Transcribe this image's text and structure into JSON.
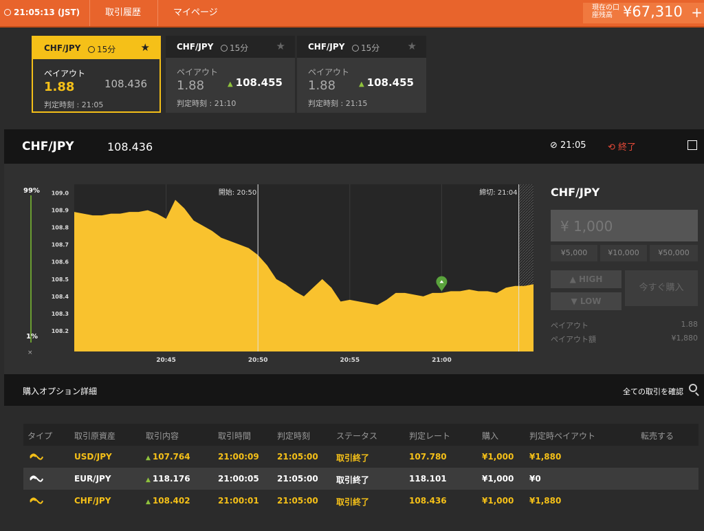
{
  "topbar": {
    "time": "21:05:13 (JST)",
    "nav": [
      "取引履歴",
      "マイページ"
    ],
    "balance_label": "現在の口座残高",
    "balance": "¥67,310",
    "plus": "+"
  },
  "cards": [
    {
      "pair": "CHF/JPY",
      "duration": "15分",
      "payout_label": "ペイアウト",
      "payout": "1.88",
      "rate": "108.436",
      "rate_arrow": false,
      "judge": "判定時刻 : 21:05",
      "active": true
    },
    {
      "pair": "CHF/JPY",
      "duration": "15分",
      "payout_label": "ペイアウト",
      "payout": "1.88",
      "rate": "108.455",
      "rate_arrow": true,
      "judge": "判定時刻 : 21:10",
      "active": false
    },
    {
      "pair": "CHF/JPY",
      "duration": "15分",
      "payout_label": "ペイアウト",
      "payout": "1.88",
      "rate": "108.455",
      "rate_arrow": true,
      "judge": "判定時刻 : 21:15",
      "active": false
    }
  ],
  "header": {
    "pair": "CHF/JPY",
    "rate": "108.436",
    "time": "21:05",
    "status": "終了"
  },
  "gauge": {
    "top": "99%",
    "bottom": "1%",
    "close": "×",
    "level": 0.99
  },
  "chart_data": {
    "type": "area",
    "title": "",
    "xlabel": "",
    "ylabel": "",
    "x_ticks": [
      "20:45",
      "20:50",
      "20:55",
      "21:00"
    ],
    "y_ticks": [
      "109.0",
      "108.9",
      "108.8",
      "108.7",
      "108.6",
      "108.5",
      "108.4",
      "108.3",
      "108.2"
    ],
    "ylim": [
      108.08,
      109.05
    ],
    "xlim": [
      0,
      25
    ],
    "start_label": "開始: 20:50",
    "end_label": "締切: 21:04",
    "start_x": 10,
    "end_x": 24.2,
    "entry": {
      "x": 20,
      "y": 108.43
    },
    "series": [
      {
        "x": [
          0,
          0.5,
          1,
          1.5,
          2,
          2.5,
          3,
          3.5,
          4,
          4.5,
          5,
          5.5,
          6,
          6.5,
          7,
          7.5,
          8,
          8.5,
          9,
          9.5,
          10,
          10.5,
          11,
          11.5,
          12,
          12.5,
          13,
          13.5,
          14,
          14.5,
          15,
          15.5,
          16,
          16.5,
          17,
          17.5,
          18,
          18.5,
          19,
          19.5,
          20,
          20.5,
          21,
          21.5,
          22,
          22.5,
          23,
          23.5,
          24,
          24.5,
          25
        ],
        "values": [
          108.89,
          108.88,
          108.87,
          108.87,
          108.88,
          108.88,
          108.89,
          108.89,
          108.9,
          108.88,
          108.85,
          108.96,
          108.91,
          108.84,
          108.81,
          108.78,
          108.74,
          108.72,
          108.7,
          108.68,
          108.64,
          108.58,
          108.5,
          108.47,
          108.43,
          108.4,
          108.45,
          108.5,
          108.45,
          108.37,
          108.38,
          108.37,
          108.36,
          108.35,
          108.38,
          108.42,
          108.42,
          108.41,
          108.4,
          108.42,
          108.42,
          108.43,
          108.43,
          108.44,
          108.43,
          108.43,
          108.42,
          108.45,
          108.46,
          108.46,
          108.47
        ]
      }
    ]
  },
  "side": {
    "pair": "CHF/JPY",
    "amount_placeholder": "¥ 1,000",
    "quick": [
      "¥5,000",
      "¥10,000",
      "¥50,000"
    ],
    "high": "HIGH",
    "low": "LOW",
    "buy": "今すぐ購入",
    "payout_label": "ペイアウト",
    "payout_value": "1.88",
    "payout_amount_label": "ペイアウト額",
    "payout_amount_value": "¥1,880"
  },
  "details": {
    "title": "購入オプション詳細",
    "all_link": "全ての取引を確認",
    "columns": [
      "タイプ",
      "取引原資産",
      "取引内容",
      "取引時間",
      "判定時刻",
      "ステータス",
      "判定レート",
      "購入",
      "判定時ペイアウト",
      "転売する"
    ],
    "rows": [
      {
        "asset": "USD/JPY",
        "content": "107.764",
        "time": "21:00:09",
        "judge": "21:05:00",
        "status": "取引終了",
        "rate": "107.780",
        "buy": "¥1,000",
        "payout": "¥1,880",
        "color": "#f5c018"
      },
      {
        "asset": "EUR/JPY",
        "content": "118.176",
        "time": "21:00:05",
        "judge": "21:05:00",
        "status": "取引終了",
        "rate": "118.101",
        "buy": "¥1,000",
        "payout": "¥0",
        "color": "#ffffff"
      },
      {
        "asset": "CHF/JPY",
        "content": "108.402",
        "time": "21:00:01",
        "judge": "21:05:00",
        "status": "取引終了",
        "rate": "108.436",
        "buy": "¥1,000",
        "payout": "¥1,880",
        "color": "#f5c018"
      }
    ]
  },
  "colors": {
    "accent": "#e8642c",
    "yellow": "#f5c018",
    "green": "#8fc23d",
    "red": "#e64a38"
  }
}
